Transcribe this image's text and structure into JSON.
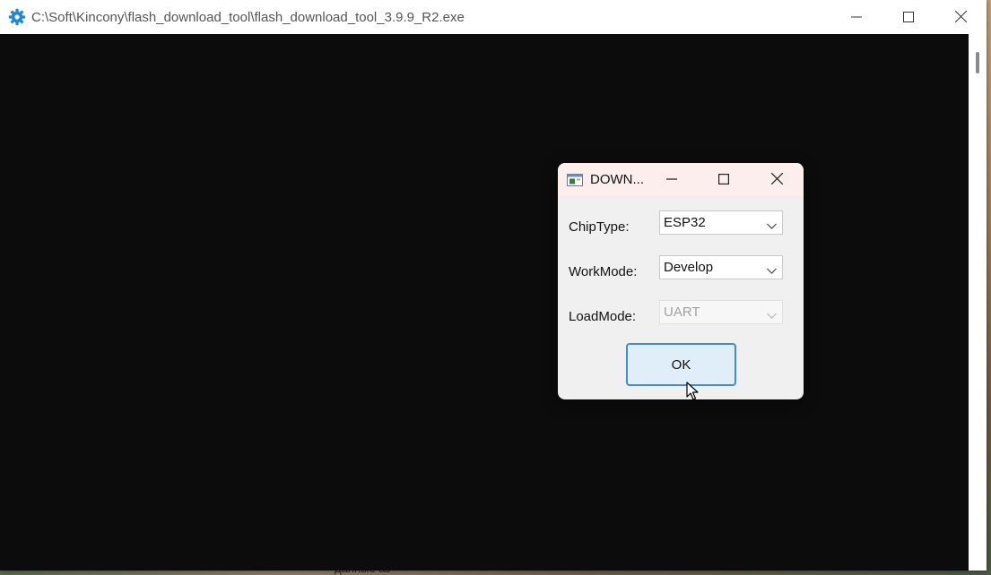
{
  "main_window": {
    "title": "C:\\Soft\\Kincony\\flash_download_tool\\flash_download_tool_3.9.9_R2.exe",
    "icon": "gear-icon",
    "icon_color": "#1e88d8",
    "console_background": "#0c0c0c"
  },
  "dialog": {
    "title": "DOWN...",
    "fields": [
      {
        "label": "ChipType:",
        "value": "ESP32",
        "enabled": true
      },
      {
        "label": "WorkMode:",
        "value": "Develop",
        "enabled": true
      },
      {
        "label": "LoadMode:",
        "value": "UART",
        "enabled": false
      }
    ],
    "ok_label": "OK",
    "accent_color": "#3c8fd6"
  },
  "desktop": {
    "bottom_text": "данные аз"
  }
}
